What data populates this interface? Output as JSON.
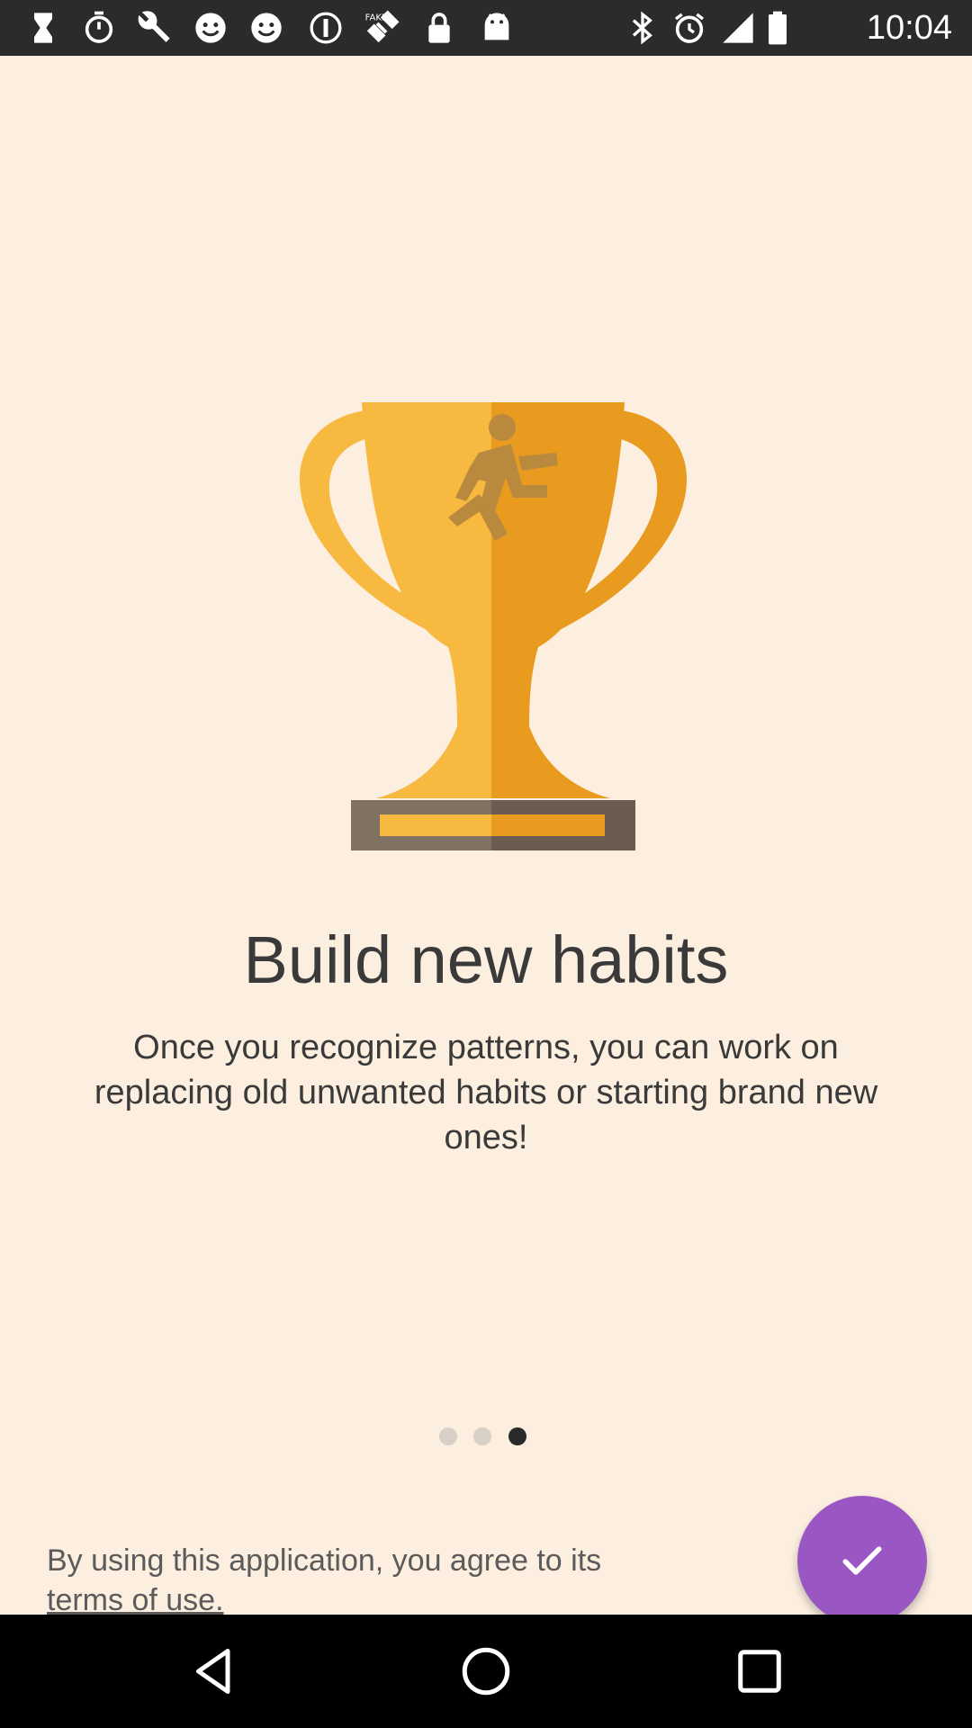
{
  "status_bar": {
    "time": "10:04",
    "left_icons": [
      "hourglass-icon",
      "stopwatch-icon",
      "wrench-icon",
      "smiley-icon",
      "smiley-icon",
      "info-icon",
      "fake-gps-icon",
      "lock-icon",
      "android-icon"
    ],
    "right_icons": [
      "bluetooth-icon",
      "alarm-icon",
      "signal-icon",
      "battery-icon"
    ]
  },
  "onboarding": {
    "title": "Build new habits",
    "subtitle": "Once you recognize patterns, you can work on replacing old unwanted habits or starting brand new ones!",
    "page_indicator": {
      "total": 3,
      "active": 3
    },
    "terms_text": "By using this application, you agree to its",
    "terms_link": "terms of use.",
    "confirm_icon": "check-icon"
  },
  "colors": {
    "background": "#fcefe0",
    "accent": "#9a57c4",
    "trophy_light": "#f7b940",
    "trophy_dark": "#e89b1e",
    "base_light": "#7f7263",
    "base_dark": "#6a5d50"
  },
  "nav_bar": {
    "buttons": [
      "back-icon",
      "home-icon",
      "recents-icon"
    ]
  }
}
